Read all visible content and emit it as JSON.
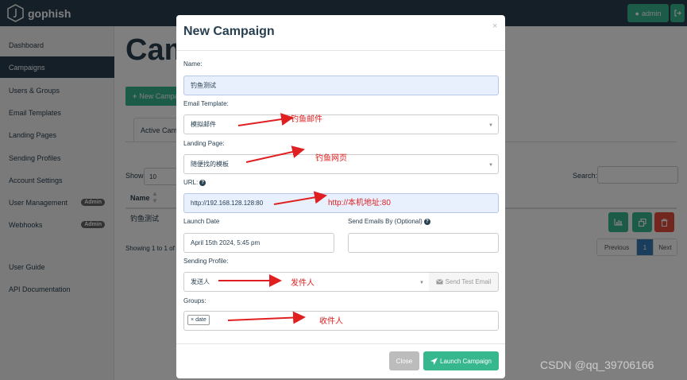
{
  "app": {
    "brand": "gophish",
    "admin_label": "admin"
  },
  "sidebar": {
    "items": [
      {
        "label": "Dashboard"
      },
      {
        "label": "Campaigns"
      },
      {
        "label": "Users & Groups"
      },
      {
        "label": "Email Templates"
      },
      {
        "label": "Landing Pages"
      },
      {
        "label": "Sending Profiles"
      },
      {
        "label": "Account Settings"
      },
      {
        "label": "User Management",
        "badge": "Admin"
      },
      {
        "label": "Webhooks",
        "badge": "Admin"
      },
      {
        "label": "User Guide"
      },
      {
        "label": "API Documentation"
      }
    ],
    "active_index": 1
  },
  "page": {
    "title": "Cam",
    "new_campaign_label": "New Campa",
    "tab_active": "Active Cam",
    "show_label": "Show",
    "show_value": "10",
    "search_label": "Search:",
    "table": {
      "col_name": "Name",
      "rows": [
        {
          "name": "钓鱼测试"
        }
      ]
    },
    "showing_text": "Showing 1 to 1 of",
    "pagination": {
      "previous": "Previous",
      "current": "1",
      "next": "Next"
    }
  },
  "modal": {
    "title": "New Campaign",
    "close_glyph": "×",
    "name_label": "Name:",
    "name_value": "钓鱼测试",
    "email_template_label": "Email Template:",
    "email_template_value": "模拟邮件",
    "landing_page_label": "Landing Page:",
    "landing_page_value": "随便找的模板",
    "url_label": "URL:",
    "url_value": "http://192.168.128.128:80",
    "launch_date_label": "Launch Date",
    "launch_date_value": "April 15th 2024, 5:45 pm",
    "send_by_label": "Send Emails By (Optional)",
    "send_by_value": "",
    "sending_profile_label": "Sending Profile:",
    "sending_profile_value": "发送人",
    "send_test_email_label": "Send Test Email",
    "groups_label": "Groups:",
    "group_tag": "date",
    "close_button": "Close",
    "launch_button": "Launch Campaign"
  },
  "annotations": {
    "email_template": "钓鱼邮件",
    "landing_page": "钓鱼网页",
    "url": "http://本机地址:80",
    "sending_profile": "发件人",
    "groups": "收件人",
    "color": "#e02020"
  },
  "watermark": "CSDN @qq_39706166",
  "colors": {
    "navbar": "#283f50",
    "primary_green": "#37b78e",
    "danger_red": "#e74c3c",
    "pager_blue": "#337ab7"
  }
}
